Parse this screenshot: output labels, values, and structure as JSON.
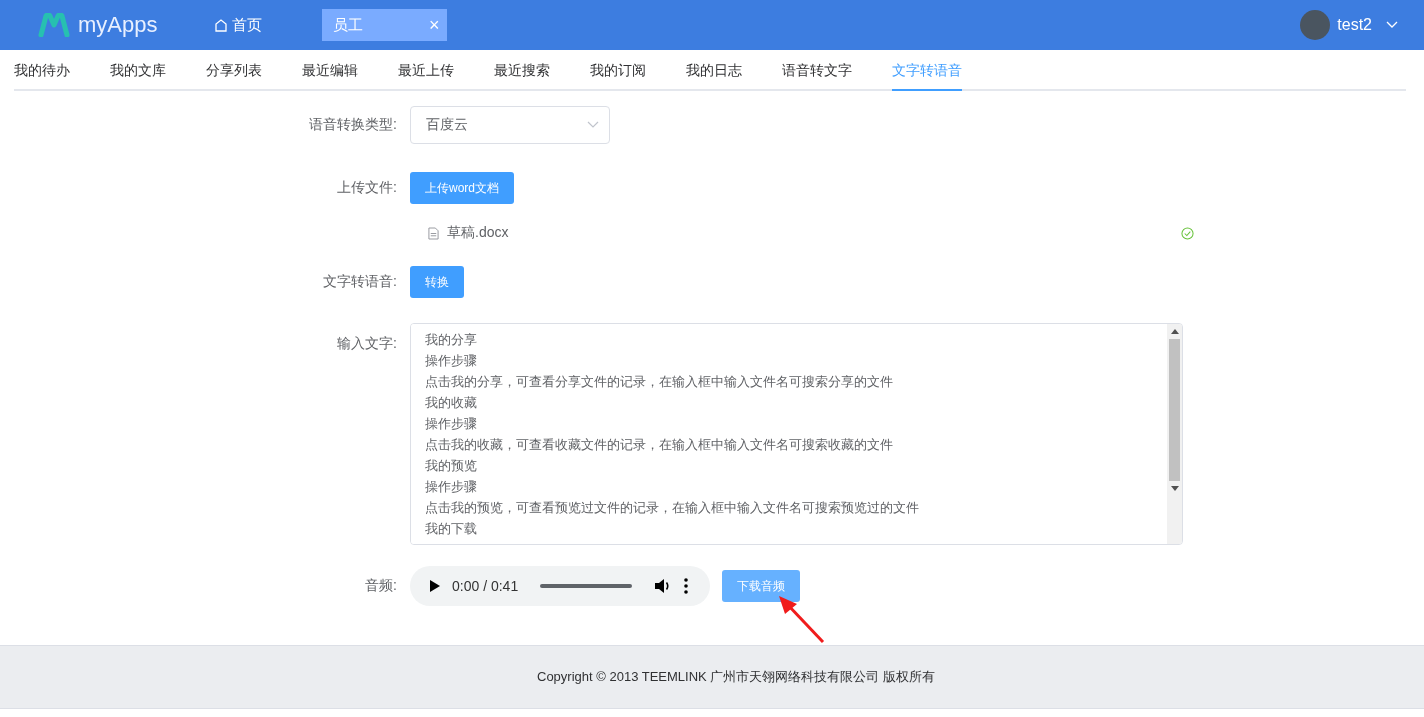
{
  "header": {
    "logo": "myApps",
    "home": "首页",
    "tabs": [
      {
        "label": "员工",
        "selected": true,
        "close": "×"
      }
    ],
    "user": "test2"
  },
  "nav": [
    {
      "label": "我的待办",
      "selected": false
    },
    {
      "label": "我的文库",
      "selected": false
    },
    {
      "label": "分享列表",
      "selected": false
    },
    {
      "label": "最近编辑",
      "selected": false
    },
    {
      "label": "最近上传",
      "selected": false
    },
    {
      "label": "最近搜索",
      "selected": false
    },
    {
      "label": "我的订阅",
      "selected": false
    },
    {
      "label": "我的日志",
      "selected": false
    },
    {
      "label": "语音转文字",
      "selected": false
    },
    {
      "label": "文字转语音",
      "selected": true
    }
  ],
  "form": {
    "type_label": "语音转换类型:",
    "type_value": "百度云",
    "upload_label": "上传文件:",
    "upload_button": "上传word文档",
    "file": {
      "name": "草稿.docx",
      "done": true
    },
    "convert_label": "文字转语音:",
    "convert_button": "转换",
    "text_label": "输入文字:",
    "text_lines": [
      "我的分享",
      "操作步骤",
      "点击我的分享，可查看分享文件的记录，在输入框中输入文件名可搜索分享的文件",
      "我的收藏",
      "操作步骤",
      "点击我的收藏，可查看收藏文件的记录，在输入框中输入文件名可搜索收藏的文件",
      "我的预览",
      "操作步骤",
      "点击我的预览，可查看预览过文件的记录，在输入框中输入文件名可搜索预览过的文件",
      "我的下载"
    ],
    "audio_label": "音频:",
    "audio": {
      "time": "0:00 / 0:41",
      "level": 0
    },
    "download_button": "下载音频"
  },
  "footer": "Copyright © 2013 TEEMLINK 广州市天翎网络科技有限公司 版权所有"
}
